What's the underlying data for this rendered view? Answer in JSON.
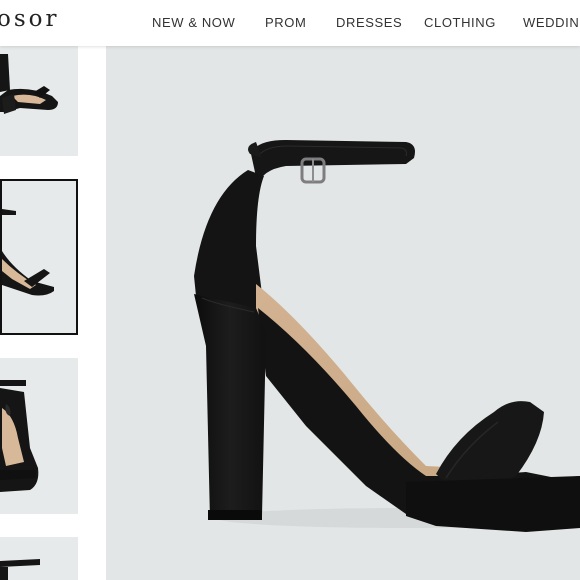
{
  "brand": {
    "logo_text": "osor"
  },
  "nav": {
    "items": [
      {
        "label": "NEW & NOW"
      },
      {
        "label": "PROM"
      },
      {
        "label": "DRESSES"
      },
      {
        "label": "CLOTHING"
      },
      {
        "label": "WEDDING"
      }
    ]
  },
  "gallery": {
    "thumbnails": [
      {
        "alt": "sandal side view",
        "selected": false
      },
      {
        "alt": "sandal side view",
        "selected": true
      },
      {
        "alt": "sandal front view",
        "selected": false
      },
      {
        "alt": "sandal view",
        "selected": false
      }
    ],
    "main_image_alt": "black block heel ankle strap sandal"
  },
  "colors": {
    "shoe": "#151515",
    "insole": "#d7b99a",
    "background": "#e3e6e6",
    "selected_border": "#111111"
  }
}
